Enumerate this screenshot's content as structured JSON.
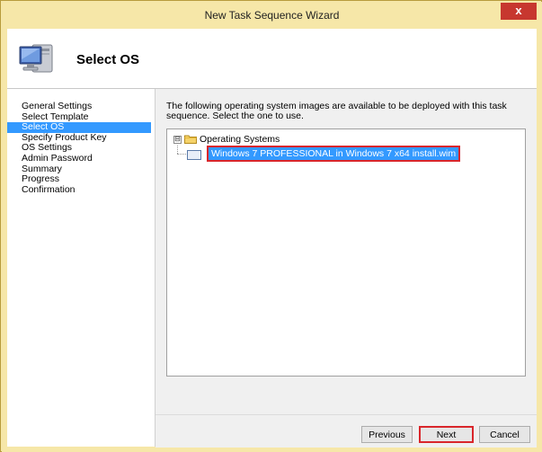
{
  "window": {
    "title": "New Task Sequence Wizard",
    "close_label": "x"
  },
  "header": {
    "title": "Select OS",
    "icon": "computer-icon"
  },
  "sidebar": {
    "items": [
      {
        "label": "General Settings",
        "active": false
      },
      {
        "label": "Select Template",
        "active": false
      },
      {
        "label": "Select OS",
        "active": true
      },
      {
        "label": "Specify Product Key",
        "active": false
      },
      {
        "label": "OS Settings",
        "active": false
      },
      {
        "label": "Admin Password",
        "active": false
      },
      {
        "label": "Summary",
        "active": false
      },
      {
        "label": "Progress",
        "active": false
      },
      {
        "label": "Confirmation",
        "active": false
      }
    ]
  },
  "main": {
    "instructions": "The following operating system images are available to be deployed with this task sequence.  Select the one to use.",
    "tree": {
      "root_label": "Operating Systems",
      "root_expander": "⊟",
      "items": [
        {
          "label": "Windows 7 PROFESSIONAL in Windows 7 x64 install.wim",
          "selected": true
        }
      ]
    }
  },
  "footer": {
    "previous_label": "Previous",
    "next_label": "Next",
    "cancel_label": "Cancel"
  },
  "colors": {
    "accent_selection": "#3399ff",
    "highlight_outline": "#d9262b",
    "window_chrome": "#f6e7a8",
    "close_button": "#c7372f"
  }
}
